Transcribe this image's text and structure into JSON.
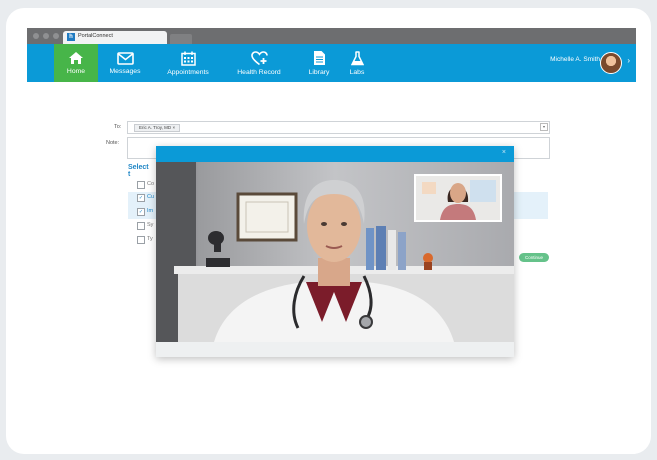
{
  "browser": {
    "tab_title": "PortalConnect",
    "tab_logo": "h"
  },
  "nav": {
    "items": [
      {
        "label": "Home",
        "icon": "home-icon",
        "active": true
      },
      {
        "label": "Messages",
        "icon": "envelope-icon"
      },
      {
        "label": "Appointments",
        "icon": "calendar-icon"
      },
      {
        "label": "Health Record",
        "icon": "heart-plus-icon"
      },
      {
        "label": "Library",
        "icon": "document-icon"
      },
      {
        "label": "Labs",
        "icon": "flask-icon"
      }
    ],
    "user_name": "Michelle A. Smith",
    "user_caret": "›"
  },
  "compose": {
    "to_label": "To:",
    "recipient": "Eric A. Troy, MD",
    "recipient_remove": "×",
    "note_label": "Note:",
    "section_title": "Select t",
    "options": [
      {
        "label": "Co",
        "checked": false
      },
      {
        "label": "Cu",
        "checked": true
      },
      {
        "label": "Im",
        "checked": true
      },
      {
        "label": "Sy",
        "checked": false
      },
      {
        "label": "Ty",
        "checked": false
      }
    ],
    "check_mark": "✓",
    "continue_label": "Continue"
  },
  "video_call": {
    "close_label": "×"
  },
  "colors": {
    "nav_blue": "#0b9ad7",
    "active_green": "#47b549",
    "link_blue": "#1f86c6"
  }
}
